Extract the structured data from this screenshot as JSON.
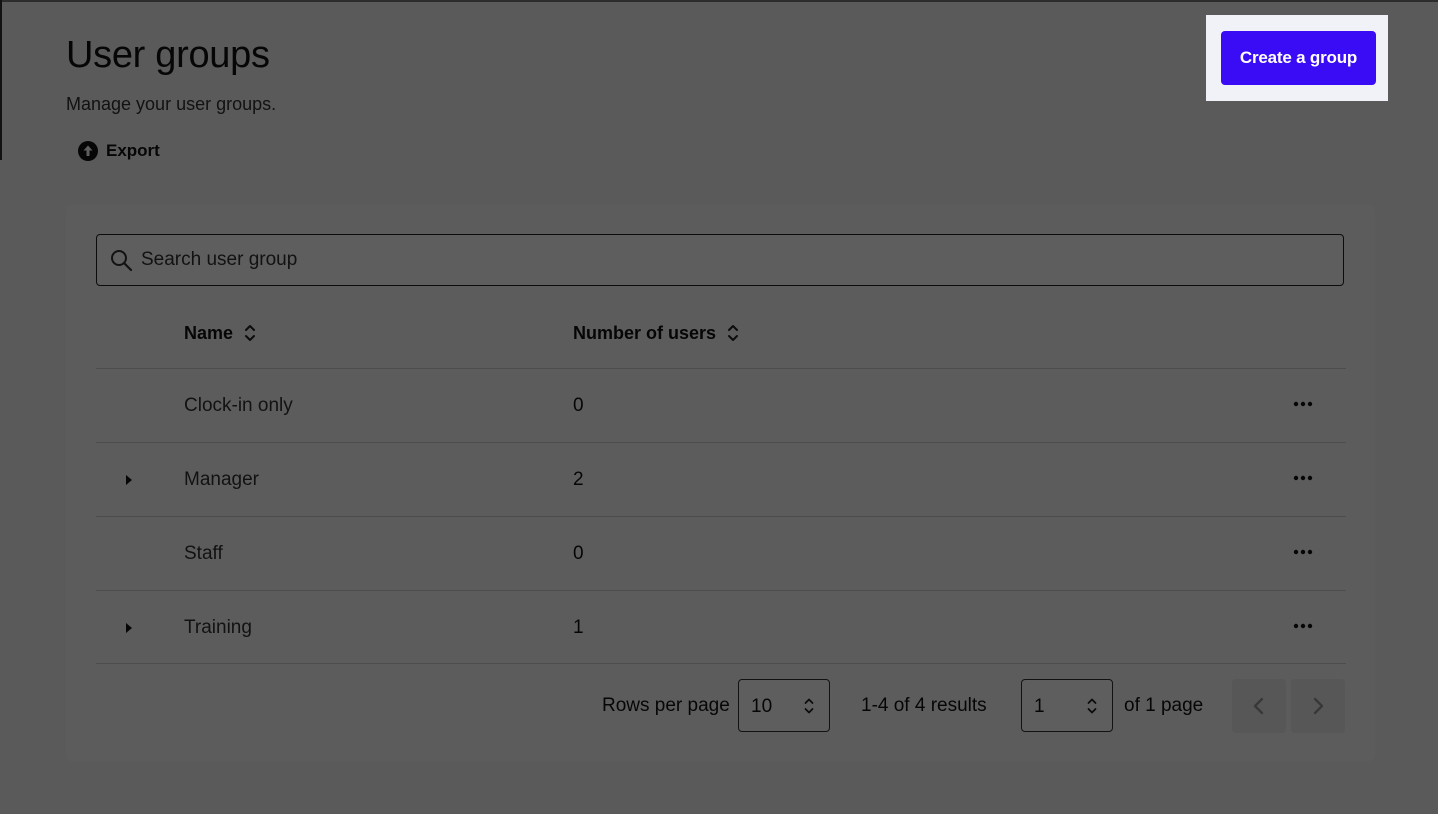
{
  "header": {
    "title": "User groups",
    "subtitle": "Manage your user groups.",
    "export_label": "Export",
    "create_label": "Create a group"
  },
  "search": {
    "placeholder": "Search user group"
  },
  "table": {
    "columns": [
      "Name",
      "Number of users"
    ],
    "rows": [
      {
        "name": "Clock-in only",
        "users": "0",
        "expandable": false
      },
      {
        "name": "Manager",
        "users": "2",
        "expandable": true
      },
      {
        "name": "Staff",
        "users": "0",
        "expandable": false
      },
      {
        "name": "Training",
        "users": "1",
        "expandable": true
      }
    ]
  },
  "pagination": {
    "rows_per_page_label": "Rows per page",
    "rows_per_page": "10",
    "results": "1-4 of 4 results",
    "page": "1",
    "page_total": "of 1 page"
  },
  "colors": {
    "accent": "#3a0cf5",
    "overlay": "rgba(0,0,0,0.63)"
  },
  "icons": {
    "export": "upload-circle-icon",
    "search": "search-icon",
    "sort": "sort-icon",
    "expand": "caret-right-icon",
    "more": "more-horizontal-icon",
    "select": "chevron-updown-icon",
    "prev": "chevron-left-icon",
    "next": "chevron-right-icon"
  }
}
